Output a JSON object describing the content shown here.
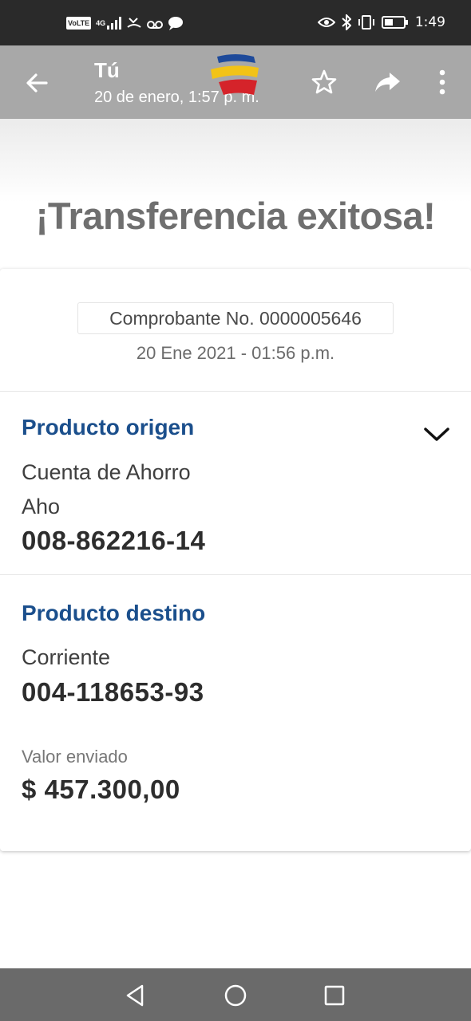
{
  "status_bar": {
    "network_badge": "VoLTE",
    "network_type": "4G",
    "time": "1:49",
    "icons": [
      "signal-icon",
      "missed-call-icon",
      "voicemail-icon",
      "chat-bubble-icon",
      "eye-icon",
      "bluetooth-icon",
      "vibrate-icon",
      "battery-icon"
    ]
  },
  "header": {
    "title": "Tú",
    "subtitle": "20 de enero, 1:57 p. m.",
    "icons": [
      "back-arrow-icon",
      "bank-logo",
      "star-icon",
      "forward-icon",
      "more-vert-icon"
    ],
    "logo_colors": [
      "#1e4a9a",
      "#f2c317",
      "#d5232a"
    ]
  },
  "hero": {
    "title": "¡Transferencia exitosa!"
  },
  "receipt": {
    "voucher_label": "Comprobante No. 0000005646",
    "date": "20 Ene 2021 - 01:56 p.m."
  },
  "origin": {
    "title": "Producto origen",
    "account_type": "Cuenta de Ahorro",
    "short_type": "Aho",
    "account_number": "008-862216-14"
  },
  "destination": {
    "title": "Producto destino",
    "account_type": "Corriente",
    "account_number": "004-118653-93"
  },
  "amount": {
    "label": "Valor enviado",
    "value": "$ 457.300,00"
  },
  "nav_bar": {
    "icons": [
      "back-triangle-icon",
      "home-circle-icon",
      "recents-square-icon"
    ]
  },
  "colors": {
    "accent": "#1b4f8c",
    "header_bg": "#a8a8a8",
    "status_bg": "#2a2a2a",
    "nav_bg": "#6a6a6a"
  }
}
